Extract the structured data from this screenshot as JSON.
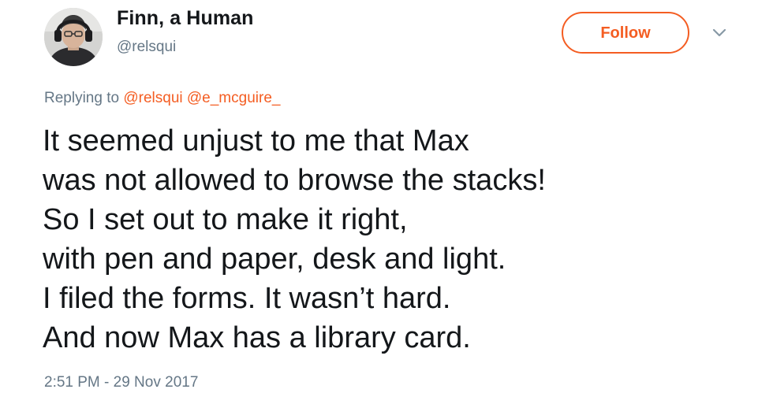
{
  "user": {
    "display_name": "Finn, a Human",
    "handle": "@relsqui"
  },
  "follow_button": {
    "label": "Follow"
  },
  "menu": {
    "icon": "chevron-down-icon"
  },
  "reply": {
    "prefix": "Replying to",
    "mentions": [
      "@relsqui",
      "@e_mcguire_"
    ]
  },
  "tweet": {
    "lines": [
      "It seemed unjust to me that Max",
      "was not allowed to browse the stacks!",
      "So I set out to make it right,",
      "with pen and paper, desk and light.",
      "I filed the forms. It wasn’t hard.",
      "And now Max has a library card."
    ]
  },
  "timestamp": "2:51 PM - 29 Nov 2017",
  "colors": {
    "accent": "#f45d22",
    "text": "#14171a",
    "secondary": "#657786"
  }
}
